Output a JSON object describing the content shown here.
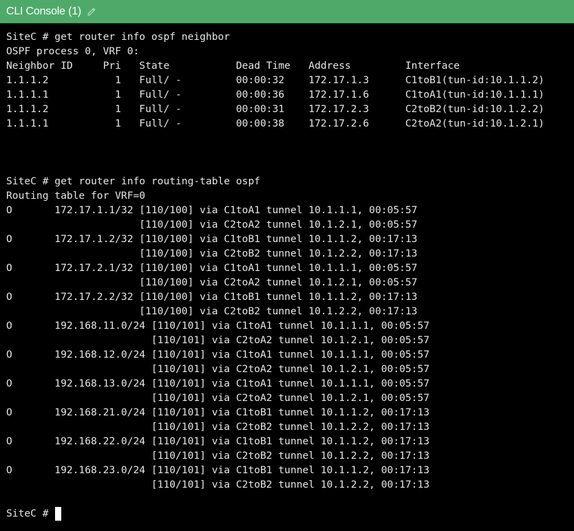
{
  "window": {
    "title": "CLI Console (1)",
    "edit_icon": "pencil-icon",
    "title_bar_color": "#4faa6a"
  },
  "terminal": {
    "background": "#000000",
    "text_color": "#e6e6e6",
    "lines": [
      "SiteC # get router info ospf neighbor",
      "OSPF process 0, VRF 0:",
      "Neighbor ID     Pri   State           Dead Time   Address         Interface",
      "1.1.1.2           1   Full/ -         00:00:32    172.17.1.3      C1toB1(tun-id:10.1.1.2)",
      "1.1.1.1           1   Full/ -         00:00:36    172.17.1.6      C1toA1(tun-id:10.1.1.1)",
      "1.1.1.2           1   Full/ -         00:00:31    172.17.2.3      C2toB2(tun-id:10.1.2.2)",
      "1.1.1.1           1   Full/ -         00:00:38    172.17.2.6      C2toA2(tun-id:10.1.2.1)",
      "",
      "",
      "",
      "SiteC # get router info routing-table ospf",
      "Routing table for VRF=0",
      "O       172.17.1.1/32 [110/100] via C1toA1 tunnel 10.1.1.1, 00:05:57",
      "                      [110/100] via C2toA2 tunnel 10.1.2.1, 00:05:57",
      "O       172.17.1.2/32 [110/100] via C1toB1 tunnel 10.1.1.2, 00:17:13",
      "                      [110/100] via C2toB2 tunnel 10.1.2.2, 00:17:13",
      "O       172.17.2.1/32 [110/100] via C1toA1 tunnel 10.1.1.1, 00:05:57",
      "                      [110/100] via C2toA2 tunnel 10.1.2.1, 00:05:57",
      "O       172.17.2.2/32 [110/100] via C1toB1 tunnel 10.1.1.2, 00:17:13",
      "                      [110/100] via C2toB2 tunnel 10.1.2.2, 00:17:13",
      "O       192.168.11.0/24 [110/101] via C1toA1 tunnel 10.1.1.1, 00:05:57",
      "                        [110/101] via C2toA2 tunnel 10.1.2.1, 00:05:57",
      "O       192.168.12.0/24 [110/101] via C1toA1 tunnel 10.1.1.1, 00:05:57",
      "                        [110/101] via C2toA2 tunnel 10.1.2.1, 00:05:57",
      "O       192.168.13.0/24 [110/101] via C1toA1 tunnel 10.1.1.1, 00:05:57",
      "                        [110/101] via C2toA2 tunnel 10.1.2.1, 00:05:57",
      "O       192.168.21.0/24 [110/101] via C1toB1 tunnel 10.1.1.2, 00:17:13",
      "                        [110/101] via C2toB2 tunnel 10.1.2.2, 00:17:13",
      "O       192.168.22.0/24 [110/101] via C1toB1 tunnel 10.1.1.2, 00:17:13",
      "                        [110/101] via C2toB2 tunnel 10.1.2.2, 00:17:13",
      "O       192.168.23.0/24 [110/101] via C1toB1 tunnel 10.1.1.2, 00:17:13",
      "                        [110/101] via C2toB2 tunnel 10.1.2.2, 00:17:13",
      ""
    ],
    "prompt": "SiteC #"
  }
}
